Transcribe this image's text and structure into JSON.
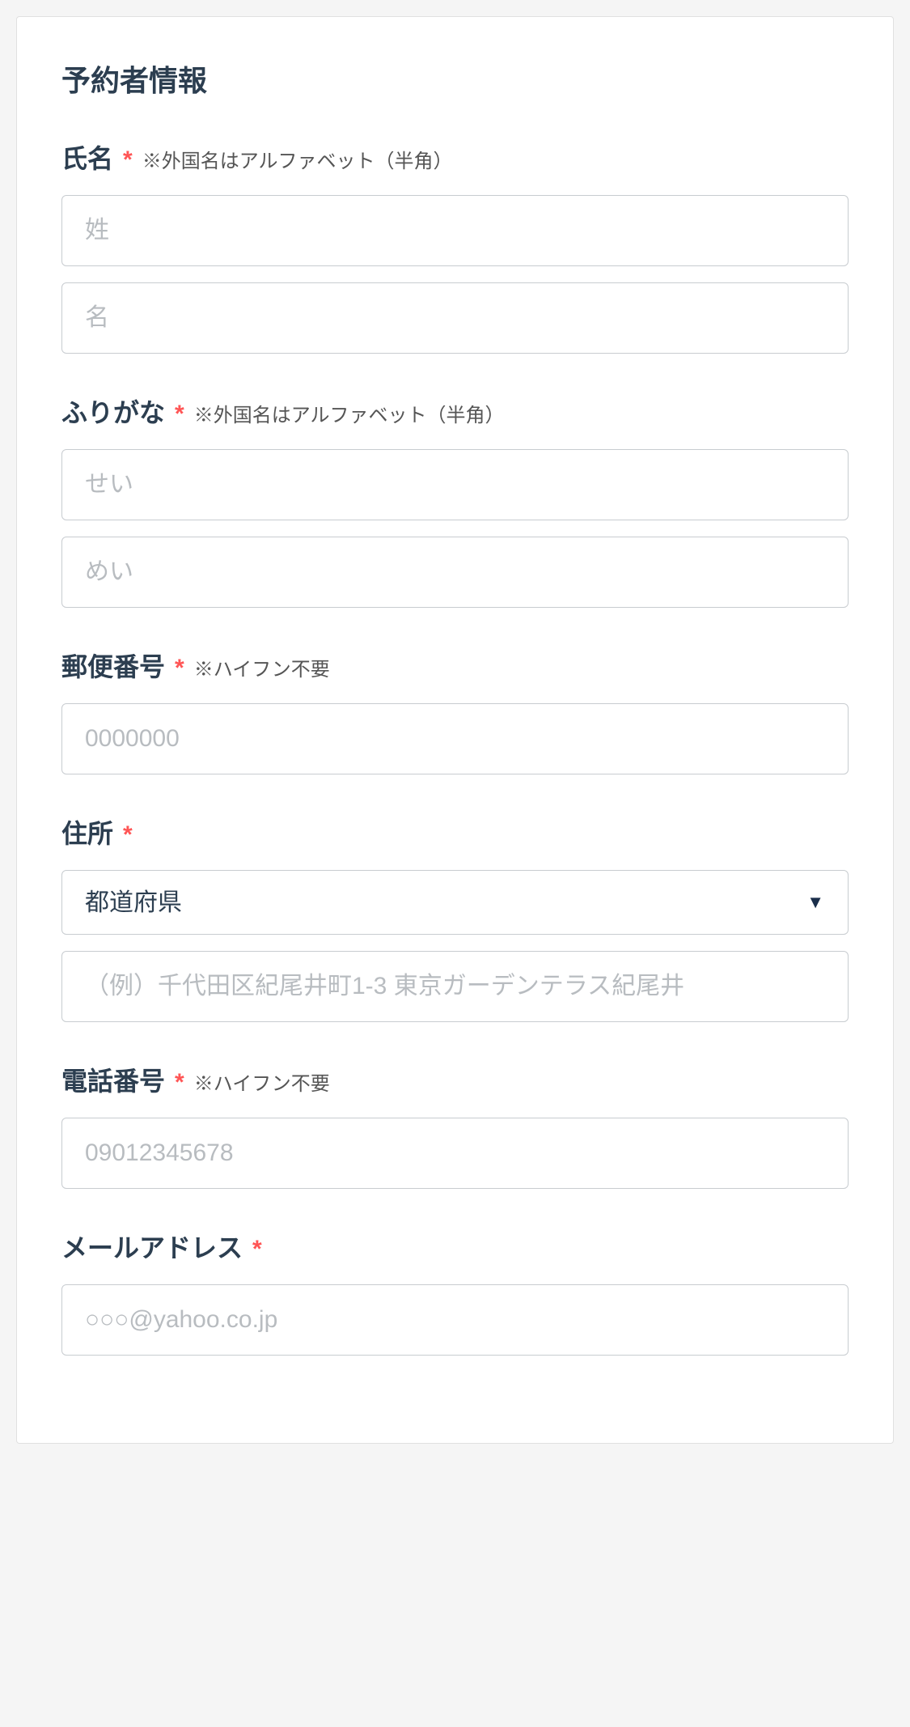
{
  "section_title": "予約者情報",
  "required_symbol": "*",
  "fields": {
    "name": {
      "label": "氏名",
      "hint": "※外国名はアルファベット（半角）",
      "last_placeholder": "姓",
      "first_placeholder": "名"
    },
    "furigana": {
      "label": "ふりがな",
      "hint": "※外国名はアルファベット（半角）",
      "last_placeholder": "せい",
      "first_placeholder": "めい"
    },
    "postal": {
      "label": "郵便番号",
      "hint": "※ハイフン不要",
      "placeholder": "0000000"
    },
    "address": {
      "label": "住所",
      "prefecture_default": "都道府県",
      "detail_placeholder": "（例）千代田区紀尾井町1-3 東京ガーデンテラス紀尾井"
    },
    "phone": {
      "label": "電話番号",
      "hint": "※ハイフン不要",
      "placeholder": "09012345678"
    },
    "email": {
      "label": "メールアドレス",
      "placeholder": "○○○@yahoo.co.jp"
    }
  }
}
